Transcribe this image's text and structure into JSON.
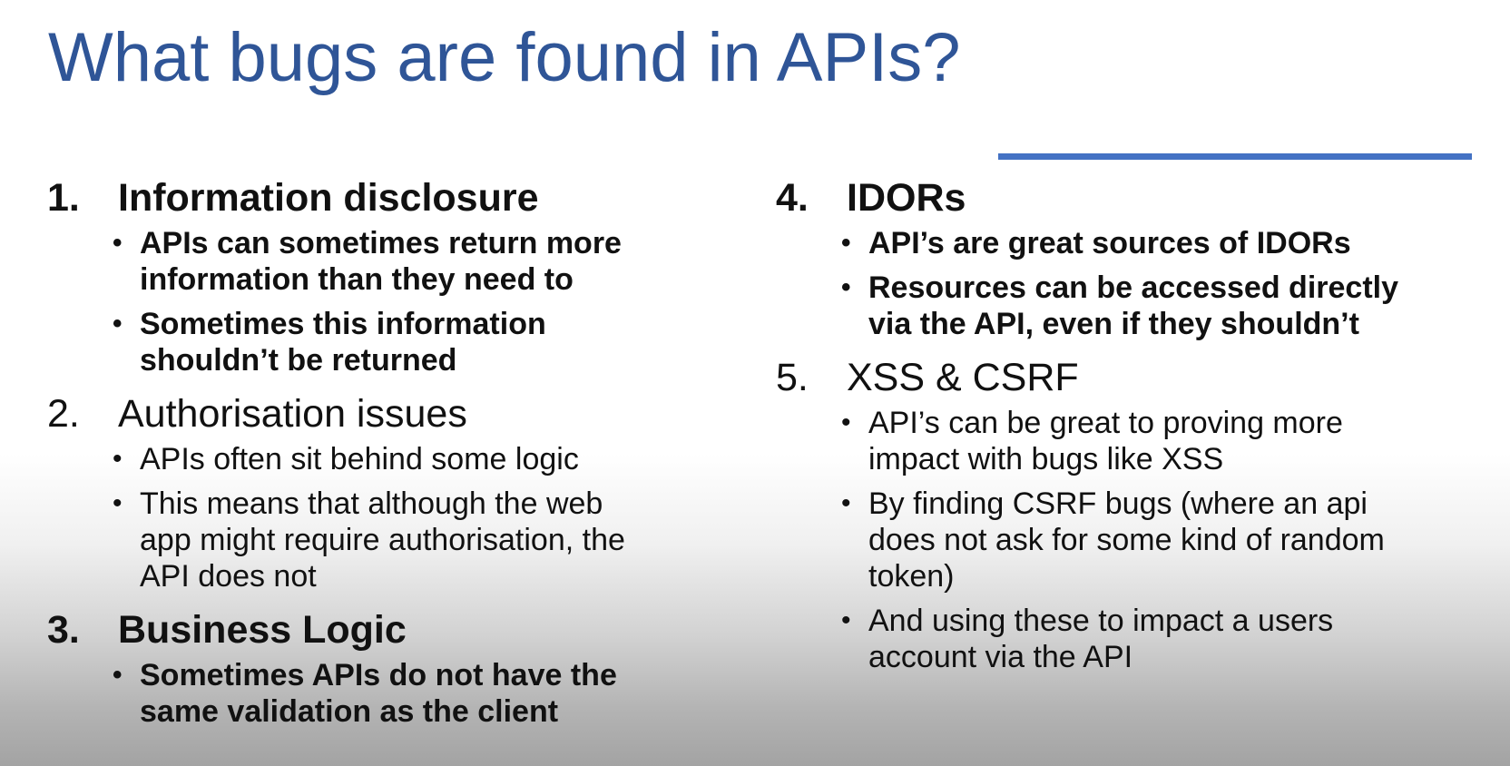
{
  "slide": {
    "title": "What bugs are found in APIs?",
    "accent_color": "#2f5597",
    "rule_color": "#4472c4"
  },
  "columns": [
    {
      "topics": [
        {
          "number": "1.",
          "heading": "Information disclosure",
          "bold": true,
          "points": [
            "APIs can sometimes return more\ninformation than they need to",
            "Sometimes this information\nshouldn’t be returned"
          ]
        },
        {
          "number": "2.",
          "heading": "Authorisation issues",
          "bold": false,
          "points": [
            "APIs often sit behind some logic",
            "This means that although the web\napp might require authorisation, the\nAPI does not"
          ]
        },
        {
          "number": "3.",
          "heading": "Business Logic",
          "bold": true,
          "points": [
            "Sometimes APIs do not have the\nsame validation as the client"
          ]
        }
      ]
    },
    {
      "topics": [
        {
          "number": "4.",
          "heading": "IDORs",
          "bold": true,
          "points": [
            "API’s are great sources of IDORs",
            "Resources can be accessed directly\nvia the API, even if they shouldn’t"
          ]
        },
        {
          "number": "5.",
          "heading": "XSS & CSRF",
          "bold": false,
          "points": [
            "API’s can be great to proving more\nimpact with bugs like XSS",
            "By finding CSRF bugs (where an api\ndoes not ask for some kind of random\ntoken)",
            "And using these to impact a users\naccount via the API"
          ]
        }
      ]
    }
  ]
}
